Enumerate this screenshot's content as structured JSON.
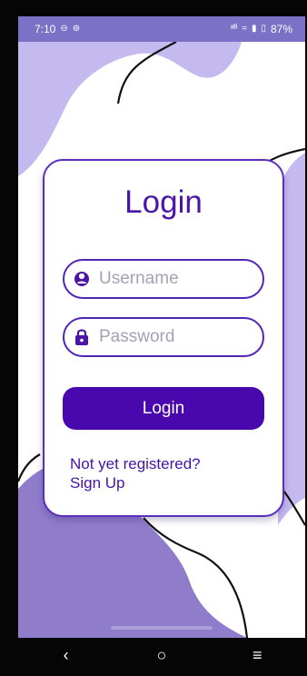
{
  "status_bar": {
    "time": "7:10",
    "left_icons": [
      "circle-icon",
      "circle-icon"
    ],
    "network_label": "ᵃᴮ",
    "battery_percent": "87%"
  },
  "login": {
    "title": "Login",
    "username_placeholder": "Username",
    "password_placeholder": "Password",
    "login_button_label": "Login",
    "register_line1": "Not yet registered?",
    "register_line2": "Sign Up"
  },
  "navigation": {
    "back_label": "‹",
    "home_label": "○",
    "menu_label": "≡"
  },
  "colors": {
    "accent": "#4808ad",
    "outline": "#5224b6",
    "light_purple": "#b9aeea",
    "status_purple": "#7b71c7"
  },
  "icons": [
    "person-icon",
    "lock-icon"
  ]
}
